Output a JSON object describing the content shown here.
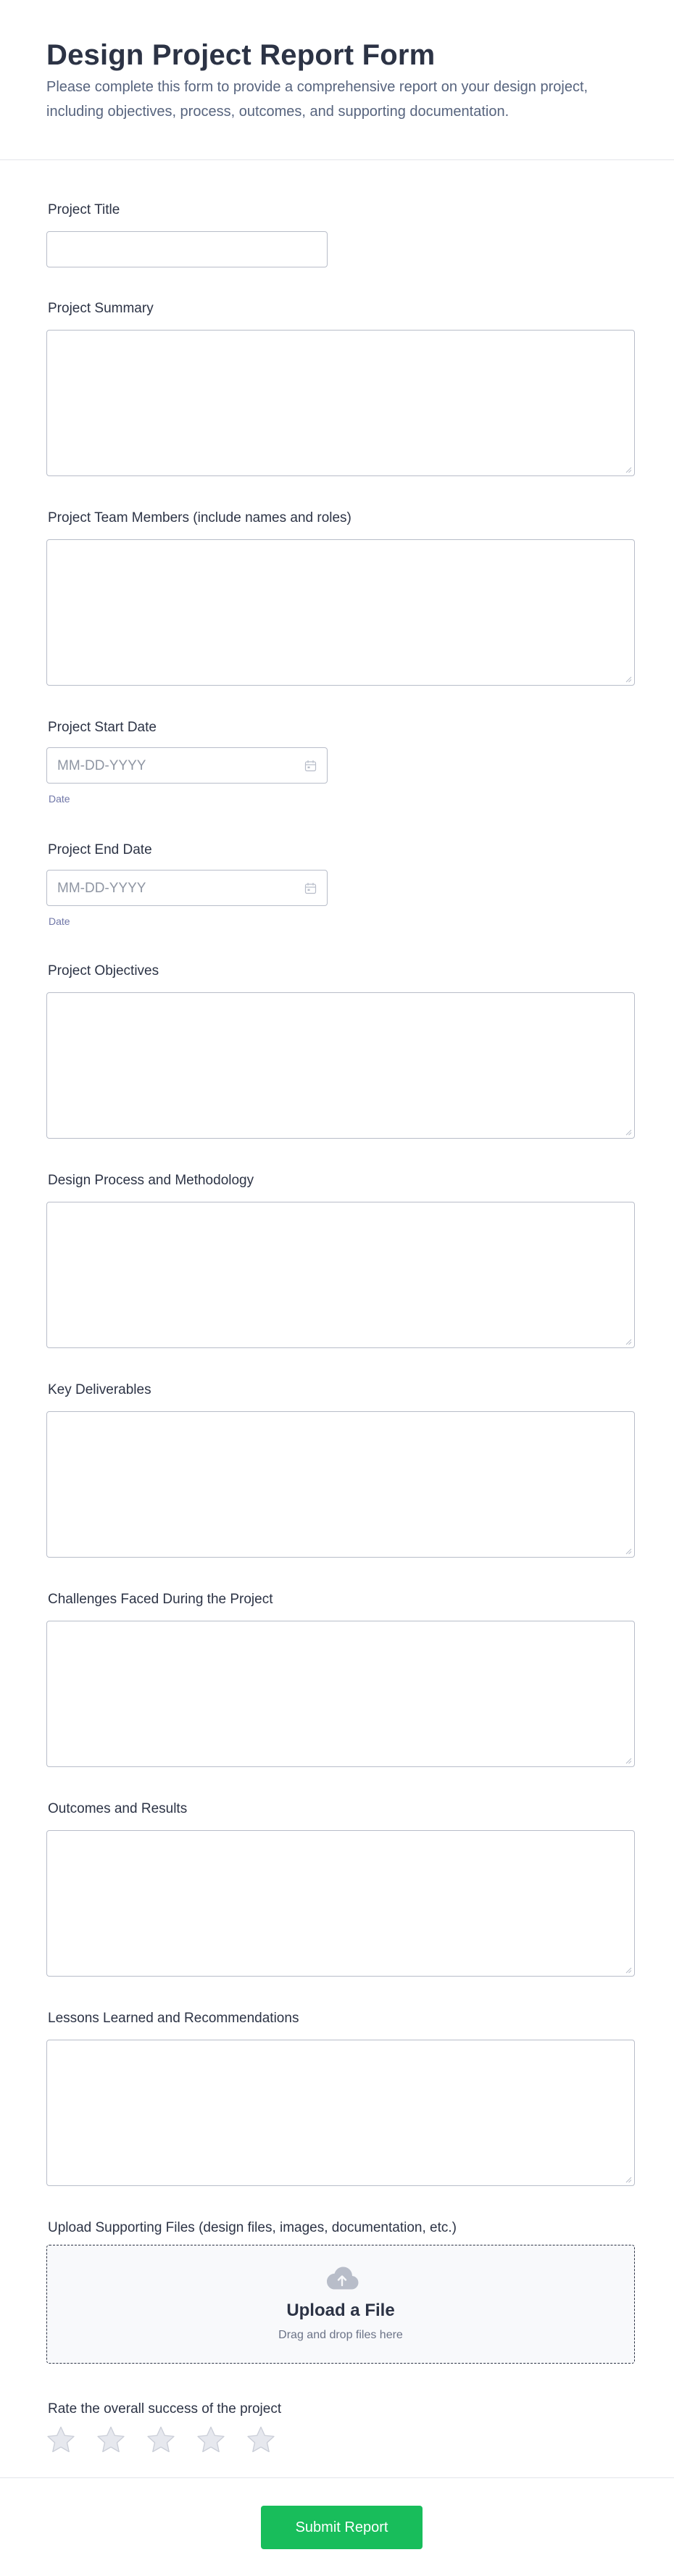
{
  "form": {
    "title": "Design Project Report Form",
    "description": "Please complete this form to provide a comprehensive report on your design project, including objectives, process, outcomes, and supporting documentation."
  },
  "fields": {
    "project_title": {
      "label": "Project Title",
      "value": ""
    },
    "project_summary": {
      "label": "Project Summary",
      "value": ""
    },
    "team_members": {
      "label": "Project Team Members (include names and roles)",
      "value": ""
    },
    "start_date": {
      "label": "Project Start Date",
      "placeholder": "MM-DD-YYYY",
      "sublabel": "Date"
    },
    "end_date": {
      "label": "Project End Date",
      "placeholder": "MM-DD-YYYY",
      "sublabel": "Date"
    },
    "objectives": {
      "label": "Project Objectives",
      "value": ""
    },
    "process": {
      "label": "Design Process and Methodology",
      "value": ""
    },
    "deliverables": {
      "label": "Key Deliverables",
      "value": ""
    },
    "challenges": {
      "label": "Challenges Faced During the Project",
      "value": ""
    },
    "outcomes": {
      "label": "Outcomes and Results",
      "value": ""
    },
    "lessons": {
      "label": "Lessons Learned and Recommendations",
      "value": ""
    },
    "upload": {
      "label": "Upload Supporting Files (design files, images, documentation, etc.)",
      "title": "Upload a File",
      "hint": "Drag and drop files here",
      "icon": "cloud-upload-icon"
    },
    "rating": {
      "label": "Rate the overall success of the project",
      "max": 5,
      "value": 0,
      "icon": "star-icon"
    }
  },
  "submit": {
    "label": "Submit Report",
    "color": "#18bd5b"
  },
  "colors": {
    "text": "#2c3345",
    "border": "#b8bdc9",
    "muted": "#57647e"
  }
}
